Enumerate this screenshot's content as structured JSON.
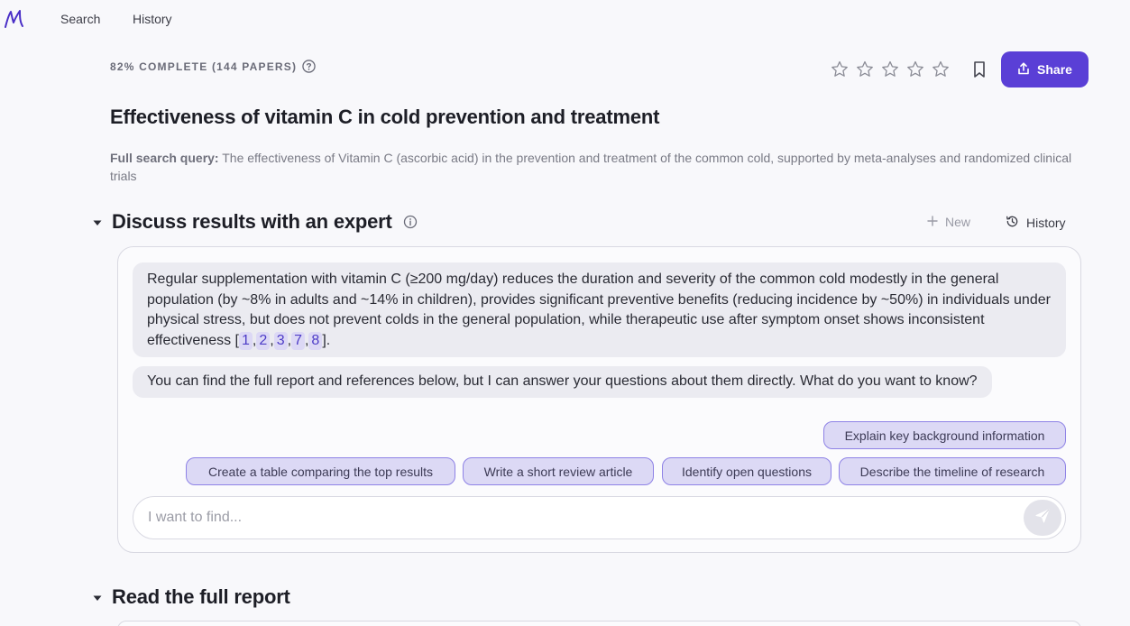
{
  "nav": {
    "logo_text": "M",
    "search_label": "Search",
    "history_label": "History"
  },
  "header": {
    "progress_text": "82% COMPLETE (144 PAPERS)",
    "rating_stars": 0,
    "rating_max": 5,
    "share_label": "Share",
    "accent_color": "#5a3fd6"
  },
  "title": "Effectiveness of vitamin C in cold prevention and treatment",
  "query": {
    "label": "Full search query:",
    "text": " The effectiveness of Vitamin C (ascorbic acid) in the prevention and treatment of the common cold, supported by meta-analyses and randomized clinical trials"
  },
  "discuss": {
    "title": "Discuss results with an expert",
    "new_label": "New",
    "history_label": "History",
    "message1": {
      "text": "Regular supplementation with vitamin C (≥200 mg/day) reduces the duration and severity of the common cold modestly in the general population (by ~8% in adults and ~14% in children), provides significant preventive benefits (reducing incidence by ~50%) in individuals under physical stress, but does not prevent colds in the general population, while therapeutic use after symptom onset shows inconsistent effectiveness [",
      "citations": [
        "1",
        "2",
        "3",
        "7",
        "8"
      ],
      "sep": ",",
      "suffix": "]."
    },
    "message2": "You can find the full report and references below, but I can answer your questions about them directly. What do you want to know?",
    "suggestions": [
      "Explain key background information",
      "Create a table comparing the top results",
      "Write a short review article",
      "Identify open questions",
      "Describe the timeline of research"
    ],
    "input_placeholder": "I want to find...",
    "input_value": ""
  },
  "report": {
    "title": "Read the full report"
  }
}
